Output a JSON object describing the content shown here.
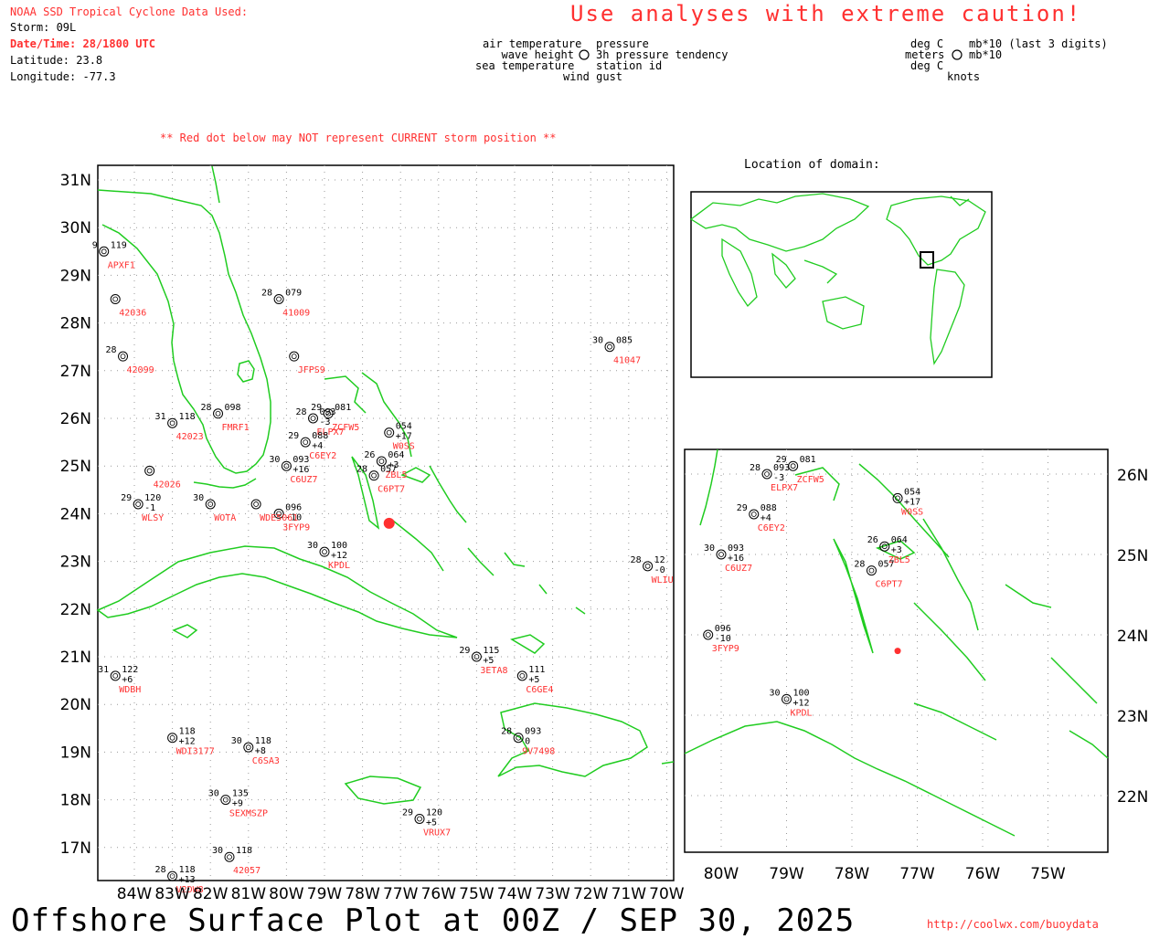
{
  "header": {
    "source": "NOAA SSD Tropical Cyclone Data Used:",
    "storm": "Storm: 09L",
    "datetime": "Date/Time: 28/1800 UTC",
    "latitude": "Latitude: 23.8",
    "longitude": "Longitude: -77.3",
    "caution": "Use analyses with extreme caution!",
    "reddot_note": "** Red dot below may NOT represent CURRENT storm position **"
  },
  "legend": {
    "left_top": "air temperature",
    "left_2": "wave height",
    "left_3": "sea temperature",
    "right_top": "pressure",
    "right_2": "3h pressure tendency",
    "right_3": "station id",
    "bottom": "wind gust",
    "u_left_1": "deg C",
    "u_left_2": "meters",
    "u_left_3": "deg C",
    "u_right_1": "mb*10 (last 3 digits)",
    "u_right_2": "mb*10",
    "u_bottom": "knots"
  },
  "inset_title": "Location of domain:",
  "footer": {
    "title": "Offshore Surface Plot at 00Z / SEP 30, 2025",
    "url": "http://coolwx.com/buoydata"
  },
  "main_map": {
    "lat_labels": [
      "31N",
      "30N",
      "29N",
      "28N",
      "27N",
      "26N",
      "25N",
      "24N",
      "23N",
      "22N",
      "21N",
      "20N",
      "19N",
      "18N",
      "17N"
    ],
    "lon_labels": [
      "84W",
      "83W",
      "82W",
      "81W",
      "80W",
      "79W",
      "78W",
      "77W",
      "76W",
      "75W",
      "74W",
      "73W",
      "72W",
      "71W",
      "70W"
    ]
  },
  "zoom_map": {
    "lat_labels": [
      "26N",
      "25N",
      "24N",
      "23N",
      "22N"
    ],
    "lon_labels": [
      "80W",
      "79W",
      "78W",
      "77W",
      "76W",
      "75W"
    ]
  },
  "storm": {
    "lat": 23.8,
    "lon": -77.3,
    "color": "#ff3030"
  },
  "colors": {
    "coast": "#20cc20",
    "station_id": "#ff3030",
    "gust": "#2040ff",
    "grid": "#999999"
  },
  "stations": [
    {
      "id": "41047",
      "lat": 27.5,
      "lon": -71.5,
      "t": "30",
      "p": "085",
      "tend": ""
    },
    {
      "id": "KPDL",
      "lat": 23.2,
      "lon": -79.0,
      "t": "30",
      "p": "100",
      "tend": "+12"
    },
    {
      "id": "WLIU",
      "lat": 22.9,
      "lon": -70.5,
      "t": "28",
      "p": "12",
      "tend": "-0"
    },
    {
      "id": "3ETA8",
      "lat": 21.0,
      "lon": -75.0,
      "t": "29",
      "p": "115",
      "tend": "+5"
    },
    {
      "id": "C6GE4",
      "lat": 20.6,
      "lon": -73.8,
      "t": "",
      "p": "111",
      "tend": "+5"
    },
    {
      "id": "WDBH",
      "lat": 20.6,
      "lon": -84.5,
      "t": "31",
      "p": "122",
      "tend": "+6"
    },
    {
      "id": "WDI3177",
      "lat": 19.3,
      "lon": -83.0,
      "t": "",
      "p": "118",
      "tend": "+12"
    },
    {
      "id": "C6SA3",
      "lat": 19.1,
      "lon": -81.0,
      "t": "30",
      "p": "118",
      "tend": "+8"
    },
    {
      "id": "9V7498",
      "lat": 19.3,
      "lon": -73.9,
      "t": "28",
      "p": "093",
      "tend": "0"
    },
    {
      "id": "SEXMSZP",
      "lat": 18.0,
      "lon": -81.6,
      "t": "30",
      "p": "135",
      "tend": "+9"
    },
    {
      "id": "VRUX7",
      "lat": 17.6,
      "lon": -76.5,
      "t": "29",
      "p": "120",
      "tend": "+5"
    },
    {
      "id": "42057",
      "lat": 16.8,
      "lon": -81.5,
      "t": "30",
      "p": "118",
      "tend": ""
    },
    {
      "id": "V2DW8",
      "lat": 16.4,
      "lon": -83.0,
      "t": "28",
      "p": "118",
      "tend": "+13"
    },
    {
      "id": "WLSY",
      "lat": 24.2,
      "lon": -83.9,
      "t": "29",
      "p": "120",
      "tend": "-1"
    },
    {
      "id": "42026",
      "lat": 24.9,
      "lon": -83.6,
      "t": "",
      "p": "",
      "tend": ""
    },
    {
      "id": "42023",
      "lat": 25.9,
      "lon": -83.0,
      "t": "31",
      "p": "118",
      "tend": ""
    },
    {
      "id": "42099",
      "lat": 27.3,
      "lon": -84.3,
      "t": "28",
      "p": "",
      "tend": ""
    },
    {
      "id": "42036",
      "lat": 28.5,
      "lon": -84.5,
      "t": "",
      "p": "",
      "tend": ""
    },
    {
      "id": "APXF1",
      "lat": 29.5,
      "lon": -84.8,
      "t": "9",
      "p": "119",
      "tend": ""
    },
    {
      "id": "W0SS",
      "lat": 25.7,
      "lon": -77.3,
      "t": "",
      "p": "054",
      "tend": "+17"
    },
    {
      "id": "ZBL5",
      "lat": 25.1,
      "lon": -77.5,
      "t": "26",
      "p": "064",
      "tend": "+3"
    },
    {
      "id": "C6PT7",
      "lat": 24.8,
      "lon": -77.7,
      "t": "28",
      "p": "057",
      "tend": ""
    },
    {
      "id": "C6UZ7",
      "lat": 25.0,
      "lon": -80.0,
      "t": "30",
      "p": "093",
      "tend": "+16"
    },
    {
      "id": "3FYP9",
      "lat": 24.0,
      "lon": -80.2,
      "t": "",
      "p": "096",
      "tend": "-10"
    },
    {
      "id": "41009",
      "lat": 28.5,
      "lon": -80.2,
      "t": "28",
      "p": "079",
      "tend": ""
    },
    {
      "id": "ELPX7",
      "lat": 26.0,
      "lon": -79.3,
      "t": "28",
      "p": "093",
      "tend": "-3"
    },
    {
      "id": "ZCFW5",
      "lat": 26.1,
      "lon": -78.9,
      "t": "29",
      "p": "081",
      "tend": ""
    },
    {
      "id": "C6EY2",
      "lat": 25.5,
      "lon": -79.5,
      "t": "29",
      "p": "088",
      "tend": "+4"
    },
    {
      "id": "FMRF1",
      "lat": 26.1,
      "lon": -81.8,
      "t": "28",
      "p": "098",
      "tend": ""
    },
    {
      "id": "WOTA",
      "lat": 24.2,
      "lon": -82.0,
      "t": "30",
      "p": "",
      "tend": ""
    },
    {
      "id": "WDE5061",
      "lat": 24.2,
      "lon": -80.8,
      "t": "",
      "p": "",
      "tend": ""
    },
    {
      "id": "JFPS9",
      "lat": 27.3,
      "lon": -79.8,
      "t": "",
      "p": "",
      "tend": ""
    }
  ]
}
